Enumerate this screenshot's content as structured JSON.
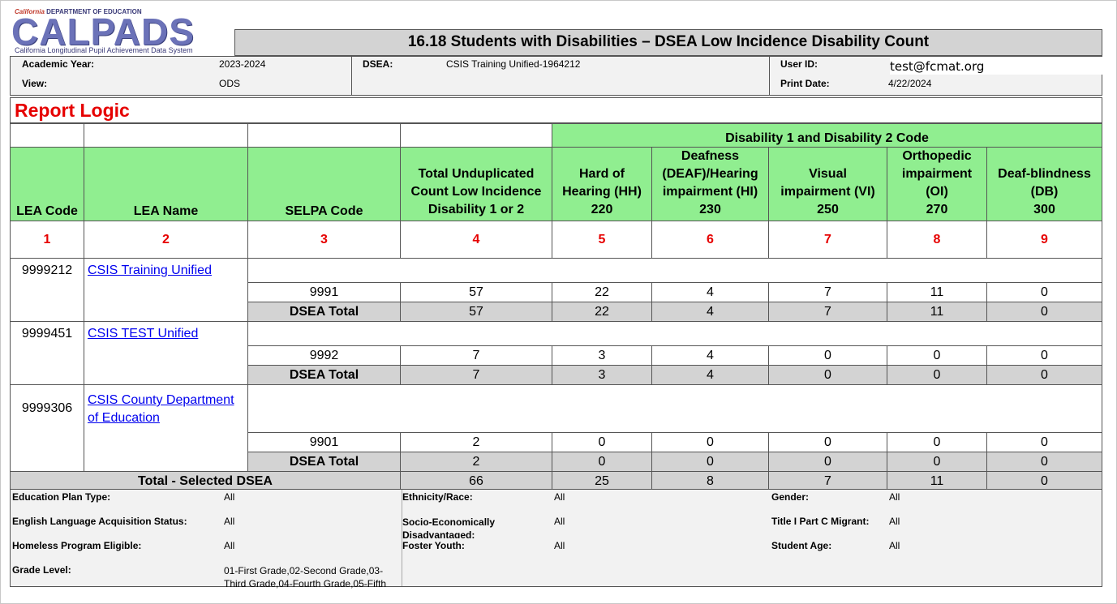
{
  "logo": {
    "top_text_brand": "California",
    "top_text": "DEPARTMENT OF EDUCATION",
    "wordmark": "CALPADS",
    "subtitle": "California Longitudinal Pupil Achievement Data System"
  },
  "report_title": "16.18 Students with Disabilities – DSEA Low Incidence Disability Count",
  "info": {
    "academic_year_label": "Academic Year:",
    "academic_year": "2023-2024",
    "view_label": "View:",
    "view": "ODS",
    "dsea_label": "DSEA:",
    "dsea": "CSIS Training Unified-1964212",
    "user_id_label": "User ID:",
    "user_id": "test@fcmat.org",
    "print_date_label": "Print Date:",
    "print_date": "4/22/2024"
  },
  "report_logic": "Report Logic",
  "table": {
    "group_header": "Disability 1 and Disability 2 Code",
    "columns": [
      {
        "label": "LEA Code",
        "number": "1"
      },
      {
        "label": "LEA Name",
        "number": "2"
      },
      {
        "label": "SELPA Code",
        "number": "3"
      },
      {
        "label": "Total Unduplicated Count Low Incidence Disability 1 or 2",
        "number": "4"
      },
      {
        "label": "Hard of Hearing (HH)",
        "code": "220",
        "number": "5"
      },
      {
        "label": "Deafness (DEAF)/Hearing impairment (HI)",
        "code": "230",
        "number": "6"
      },
      {
        "label": "Visual impairment (VI)",
        "code": "250",
        "number": "7"
      },
      {
        "label": "Orthopedic impairment (OI)",
        "code": "270",
        "number": "8"
      },
      {
        "label": "Deaf-blindness (DB)",
        "code": "300",
        "number": "9"
      }
    ],
    "leas": [
      {
        "code": "9999212",
        "name": "CSIS Training Unified",
        "selpa": "9991",
        "values": [
          "57",
          "22",
          "4",
          "7",
          "11",
          "0"
        ],
        "total_label": "DSEA Total",
        "totals": [
          "57",
          "22",
          "4",
          "7",
          "11",
          "0"
        ]
      },
      {
        "code": "9999451",
        "name": "CSIS TEST Unified",
        "selpa": "9992",
        "values": [
          "7",
          "3",
          "4",
          "0",
          "0",
          "0"
        ],
        "total_label": "DSEA Total",
        "totals": [
          "7",
          "3",
          "4",
          "0",
          "0",
          "0"
        ]
      },
      {
        "code": "9999306",
        "name": "CSIS County Department of Education",
        "selpa": "9901",
        "values": [
          "2",
          "0",
          "0",
          "0",
          "0",
          "0"
        ],
        "total_label": "DSEA Total",
        "totals": [
          "2",
          "0",
          "0",
          "0",
          "0",
          "0"
        ]
      }
    ],
    "grand_total_label": "Total - Selected DSEA",
    "grand_totals": [
      "66",
      "25",
      "8",
      "7",
      "11",
      "0"
    ]
  },
  "filters": {
    "education_plan_type_label": "Education Plan Type:",
    "education_plan_type": "All",
    "ela_status_label": "English Language Acquisition Status:",
    "ela_status": "All",
    "homeless_label": "Homeless Program Eligible:",
    "homeless": "All",
    "grade_level_label": "Grade Level:",
    "grade_level": "01-First Grade,02-Second Grade,03-Third Grade,04-Fourth Grade,05-Fifth",
    "ethnicity_label": "Ethnicity/Race:",
    "ethnicity": "All",
    "socio_label": "Socio-Economically Disadvantaged:",
    "socio": "All",
    "foster_label": "Foster Youth:",
    "foster": "All",
    "gender_label": "Gender:",
    "gender": "All",
    "title1_label": "Title I Part C Migrant:",
    "title1": "All",
    "age_label": "Student Age:",
    "age": "All"
  },
  "colors": {
    "header_green": "#90ee90",
    "total_gray": "#d3d3d3",
    "accent_red": "#e60000",
    "link_blue": "#0000ee"
  }
}
